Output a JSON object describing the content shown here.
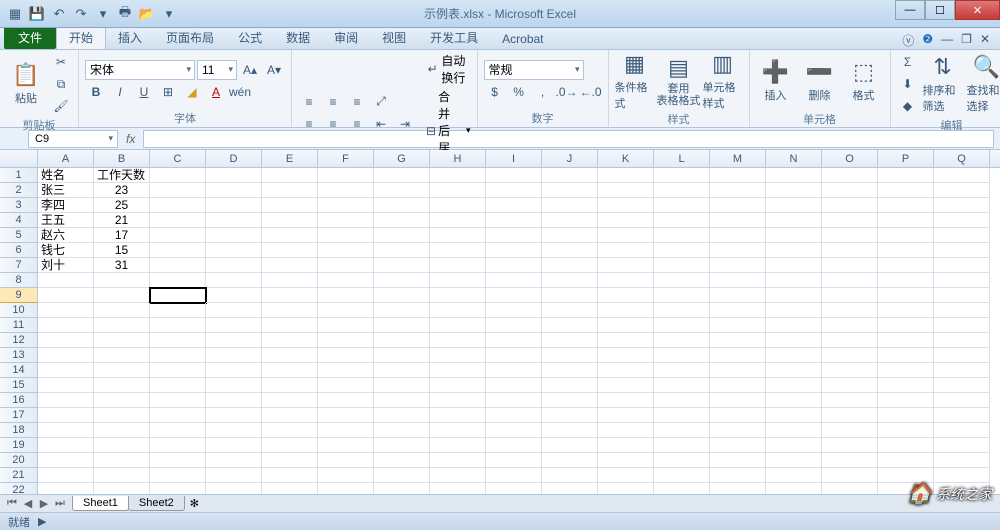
{
  "title": "示例表.xlsx - Microsoft Excel",
  "qat": [
    "save",
    "undo",
    "redo",
    "print",
    "open",
    "new"
  ],
  "tabs": {
    "file": "文件",
    "items": [
      "开始",
      "插入",
      "页面布局",
      "公式",
      "数据",
      "审阅",
      "视图",
      "开发工具",
      "Acrobat"
    ],
    "active": 0
  },
  "ribbon": {
    "clipboard": {
      "label": "剪贴板",
      "paste": "粘贴"
    },
    "font": {
      "label": "字体",
      "name": "宋体",
      "size": "11"
    },
    "align": {
      "label": "对齐方式",
      "wrap": "自动换行",
      "merge": "合并后居中"
    },
    "number": {
      "label": "数字",
      "format": "常规"
    },
    "styles": {
      "label": "样式",
      "cond": "条件格式",
      "table": "套用\n表格格式",
      "cell": "单元格样式"
    },
    "cells": {
      "label": "单元格",
      "insert": "插入",
      "delete": "删除",
      "format": "格式"
    },
    "editing": {
      "label": "编辑",
      "sort": "排序和筛选",
      "find": "查找和选择"
    }
  },
  "namebox": "C9",
  "fx": "fx",
  "columns": [
    "A",
    "B",
    "C",
    "D",
    "E",
    "F",
    "G",
    "H",
    "I",
    "J",
    "K",
    "L",
    "M",
    "N",
    "O",
    "P",
    "Q"
  ],
  "rowcount": 23,
  "selectedRow": 9,
  "selectedCol": 2,
  "data": {
    "1": {
      "A": "姓名",
      "B": "工作天数"
    },
    "2": {
      "A": "张三",
      "B": "23"
    },
    "3": {
      "A": "李四",
      "B": "25"
    },
    "4": {
      "A": "王五",
      "B": "21"
    },
    "5": {
      "A": "赵六",
      "B": "17"
    },
    "6": {
      "A": "钱七",
      "B": "15"
    },
    "7": {
      "A": "刘十",
      "B": "31"
    }
  },
  "sheets": [
    "Sheet1",
    "Sheet2"
  ],
  "status": "就绪",
  "watermark": "系统之家"
}
